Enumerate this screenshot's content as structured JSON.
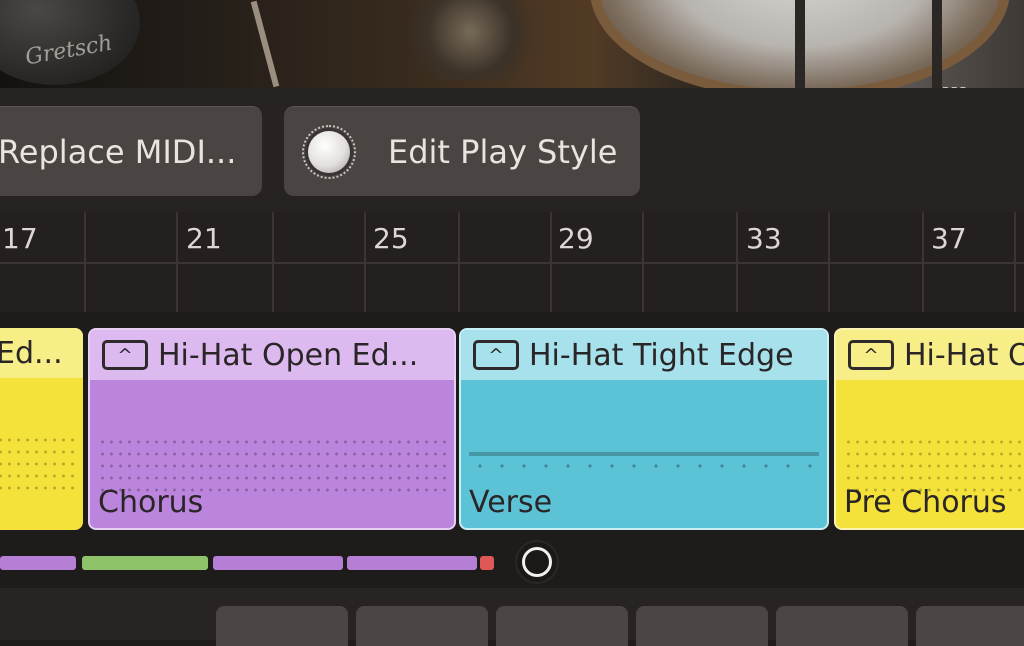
{
  "toolbar": {
    "replace_midi_label": "Replace MIDI...",
    "edit_play_style_label": "Edit Play Style"
  },
  "timeline": {
    "bar_numbers": [
      "17",
      "21",
      "25",
      "29",
      "33",
      "37"
    ]
  },
  "clips": [
    {
      "title": "Ed...",
      "section": "",
      "color": "#f4e23a"
    },
    {
      "title": "Hi-Hat Open Ed...",
      "section": "Chorus",
      "color": "#bb85dd"
    },
    {
      "title": "Hi-Hat Tight Edge",
      "section": "Verse",
      "color": "#5cc2d6"
    },
    {
      "title": "Hi-Hat O",
      "section": "Pre Chorus",
      "color": "#f4e23a"
    }
  ],
  "song_structure": {
    "segment_colors": [
      "#b57fd6",
      "#8fc36a",
      "#b57fd6",
      "#b57fd6",
      "#e05757"
    ]
  },
  "icons": {
    "collapse": "chevron-up-icon",
    "play_style": "knob-icon",
    "playhead": "playhead-circle-icon"
  }
}
